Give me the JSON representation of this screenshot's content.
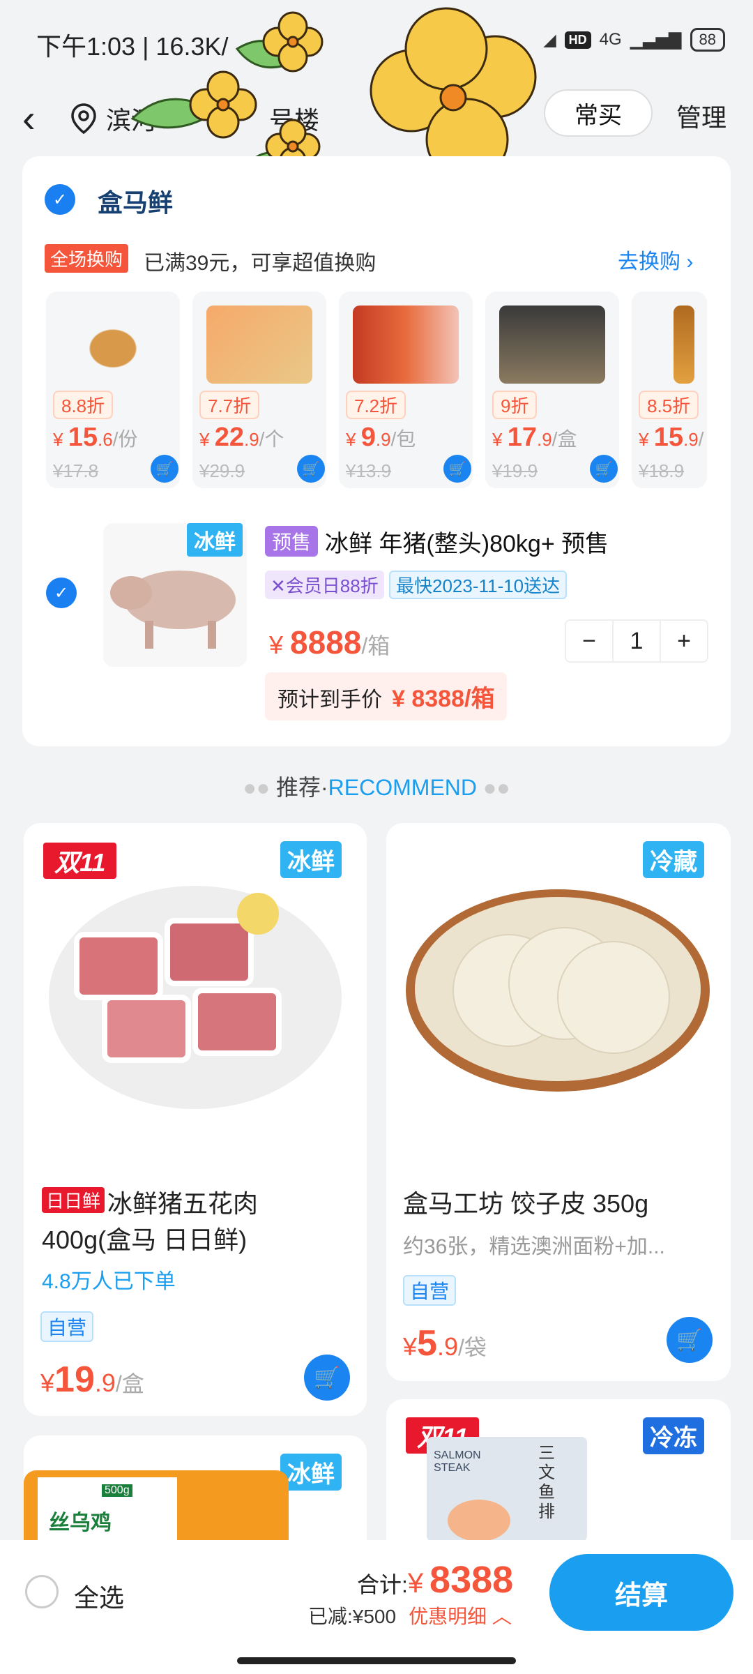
{
  "status": {
    "time": "下午1:03 | 16.3K/",
    "network": "4G",
    "battery": "88"
  },
  "nav": {
    "location": "滨河",
    "location_suffix": "号楼",
    "frequent_label": "常买",
    "manage_label": "管理"
  },
  "store": {
    "name": "盒马鲜"
  },
  "promo": {
    "tag": "全场换购",
    "text": "已满39元，可享超值换购",
    "link": "去换购"
  },
  "mini_items": [
    {
      "discount": "8.8折",
      "currency": "¥",
      "price_int": "15",
      "price_dec": ".6",
      "unit": "/份",
      "old": "¥17.8"
    },
    {
      "discount": "7.7折",
      "currency": "¥",
      "price_int": "22",
      "price_dec": ".9",
      "unit": "/个",
      "old": "¥29.9"
    },
    {
      "discount": "7.2折",
      "currency": "¥",
      "price_int": "9",
      "price_dec": ".9",
      "unit": "/包",
      "old": "¥13.9"
    },
    {
      "discount": "9折",
      "currency": "¥",
      "price_int": "17",
      "price_dec": ".9",
      "unit": "/盒",
      "old": "¥19.9"
    },
    {
      "discount": "8.5折",
      "currency": "¥",
      "price_int": "15",
      "price_dec": ".9",
      "unit": "/",
      "old": "¥18.9"
    }
  ],
  "cart_item": {
    "img_tag": "冰鲜",
    "presale_tag": "预售",
    "title": "冰鲜 年猪(整头)80kg+  预售",
    "member_badge": "会员日88折",
    "delivery_badge": "最快2023-11-10送达",
    "currency": "¥",
    "price": "8888",
    "unit": "/箱",
    "quantity": "1",
    "est_label": "预计到手价",
    "est_price": "¥ 8388/箱"
  },
  "recommend": {
    "label": "推荐·",
    "label_en": "RECOMMEND"
  },
  "goods": [
    {
      "badge": "双11",
      "tag": "冰鲜",
      "fresh_tag": "日日鲜",
      "name1": "冰鲜猪五花肉",
      "name2": "400g(盒马 日日鲜)",
      "sold": "4.8万人已下单",
      "self": "自营",
      "currency": "¥",
      "price_int": "19",
      "price_dec": ".9",
      "unit": "/盒"
    },
    {
      "tag": "冷藏",
      "name1": "盒马工坊 饺子皮 350g",
      "desc": "约36张，精选澳洲面粉+加...",
      "self": "自营",
      "currency": "¥",
      "price_int": "5",
      "price_dec": ".9",
      "unit": "/袋"
    },
    {
      "tag": "冰鲜",
      "pkg_text": "丝乌鸡",
      "pkg_weight": "500g"
    },
    {
      "badge": "双11",
      "tag": "冷冻",
      "pkg_text": "三文鱼排",
      "pkg_en": "SALMON STEAK"
    }
  ],
  "bottom": {
    "select_all": "全选",
    "total_label": "合计:",
    "currency": "¥",
    "total": "8388",
    "saved": "已减:¥500",
    "detail": "优惠明细",
    "checkout": "结算"
  },
  "colors": {
    "accent": "#1a84f0",
    "price": "#f5553a",
    "checkout": "#1a9ef0"
  }
}
